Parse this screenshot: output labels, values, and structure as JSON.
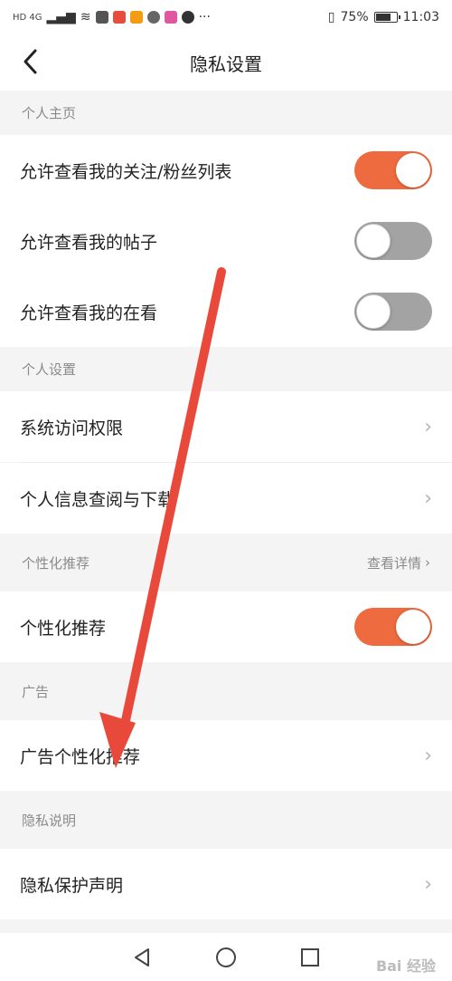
{
  "status_bar": {
    "network": "HD 4G",
    "battery": "75%",
    "battery_level": 0.75,
    "time": "11:03",
    "more": "···"
  },
  "header": {
    "back_icon": "chevron-left-icon",
    "title": "隐私设置"
  },
  "sections": {
    "personal_home": {
      "title": "个人主页"
    },
    "personal_settings": {
      "title": "个人设置"
    },
    "personalized": {
      "title": "个性化推荐",
      "detail": "查看详情"
    },
    "ads": {
      "title": "广告"
    },
    "privacy_notes": {
      "title": "隐私说明"
    }
  },
  "rows": {
    "follow_list": {
      "label": "允许查看我的关注/粉丝列表",
      "toggle": true
    },
    "posts": {
      "label": "允许查看我的帖子",
      "toggle": false
    },
    "watching": {
      "label": "允许查看我的在看",
      "toggle": false
    },
    "system_access": {
      "label": "系统访问权限"
    },
    "personal_info": {
      "label": "个人信息查阅与下载"
    },
    "personalized_rec": {
      "label": "个性化推荐",
      "toggle": true
    },
    "ad_personalized": {
      "label": "广告个性化推荐"
    },
    "privacy_statement": {
      "label": "隐私保护声明"
    }
  },
  "colors": {
    "accent": "#ee6a3f",
    "toggle_off": "#a3a3a3",
    "arrow": "#e8493a"
  },
  "watermark": "Bai 经验"
}
